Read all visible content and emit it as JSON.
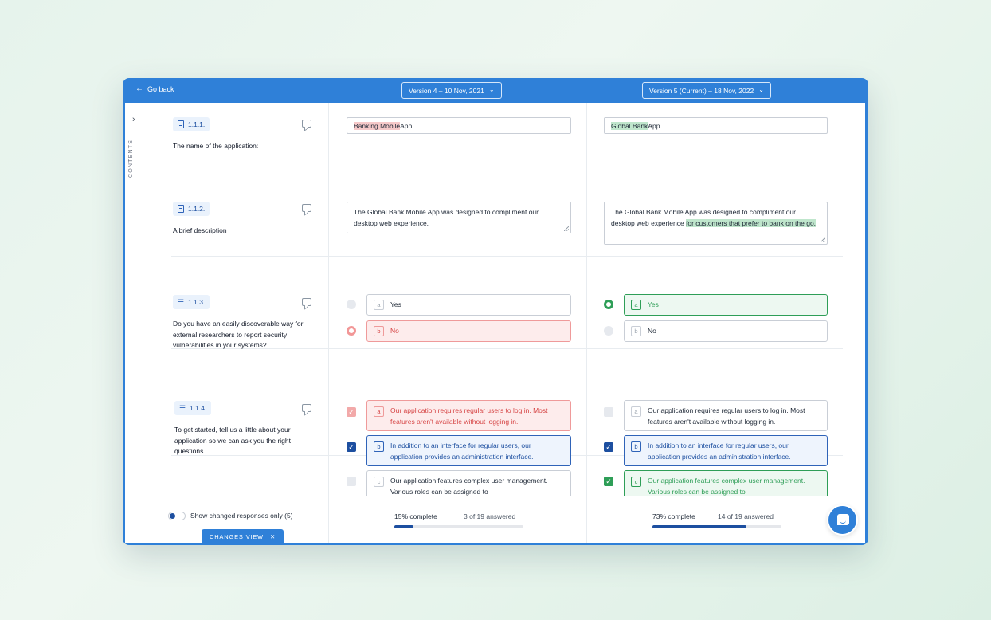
{
  "header": {
    "back_label": "Go back",
    "left_version": "Version 4 – 10 Nov, 2021",
    "right_version": "Version 5 (Current) – 18 Nov, 2022"
  },
  "sidebar": {
    "label": "CONTENTS"
  },
  "questions": [
    {
      "number": "1.1.1.",
      "text": "The name of the application:",
      "left": {
        "highlight": "Banking Mobile",
        "rest": " App"
      },
      "right": {
        "highlight": "Global Bank",
        "rest": " App"
      }
    },
    {
      "number": "1.1.2.",
      "text": "A brief description",
      "left": {
        "text": "The Global Bank Mobile App was designed to compliment our desktop web experience."
      },
      "right": {
        "plain": "The Global Bank Mobile App was designed to compliment our desktop web experience ",
        "highlight": "for customers that prefer to bank on the go."
      }
    },
    {
      "number": "1.1.3.",
      "text": "Do you have an easily discoverable way for external researchers to report security vulnerabilities in your systems?",
      "options": [
        {
          "letter": "a",
          "label": "Yes"
        },
        {
          "letter": "b",
          "label": "No"
        }
      ]
    },
    {
      "number": "1.1.4.",
      "text": "To get started, tell us a little about your application so we can ask you the right questions.",
      "options": [
        {
          "letter": "a",
          "label": "Our application requires regular users to log in. Most features aren't available without logging in."
        },
        {
          "letter": "b",
          "label": "In addition to an interface for regular users, our application provides an administration interface."
        },
        {
          "letter": "c",
          "label": "Our application features complex user management. Various roles can be assigned to"
        }
      ]
    }
  ],
  "footer": {
    "toggle_label": "Show changed responses only (5)",
    "changes_tab": "CHANGES VIEW",
    "left_progress": {
      "percent_label": "15% complete",
      "answered": "3 of 19 answered",
      "fraction": 0.15
    },
    "right_progress": {
      "percent_label": "73% complete",
      "answered": "14 of 19 answered",
      "fraction": 0.73
    }
  },
  "colors": {
    "accent": "#2f80d8",
    "removed": "#d64545",
    "added": "#2e9e57",
    "selected": "#1d4fa0"
  }
}
